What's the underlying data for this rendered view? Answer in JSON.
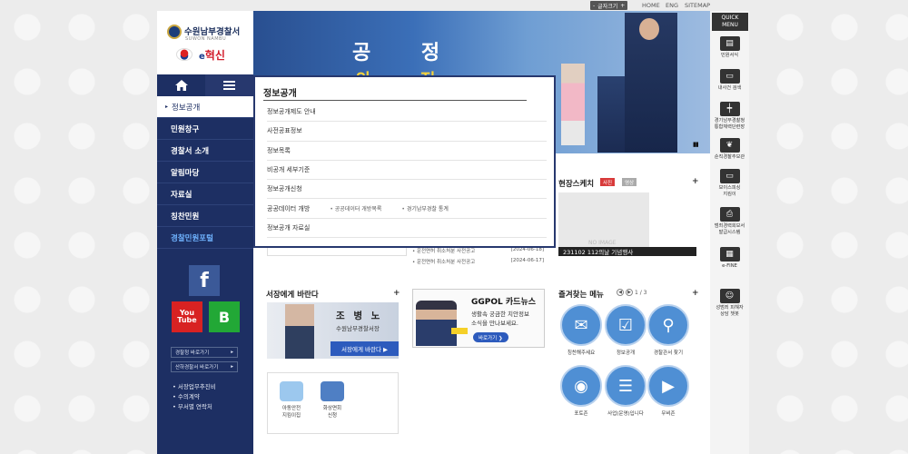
{
  "topbar": {
    "font_size_label": "글자크기",
    "font_minus": "-",
    "font_plus": "+",
    "links": [
      "HOME",
      "ENG",
      "SITEMAP"
    ]
  },
  "logo": {
    "title": "수원남부경찰서",
    "subtitle": "SUWON NAMBU",
    "slogan_e": "e",
    "slogan": "혁신"
  },
  "side_menu": [
    "정보공개",
    "민원창구",
    "경찰서 소개",
    "알림마당",
    "자료실",
    "칭찬민원",
    "경찰민원포털"
  ],
  "sns": {
    "facebook": "f",
    "youtube": "You Tube",
    "blog": "B"
  },
  "left_links": {
    "buttons": [
      "경찰청 바로가기",
      "산하경찰서 바로가기"
    ],
    "links": [
      "• 서장업무추진비",
      "• 수의계약",
      "• 부서별 연락처"
    ]
  },
  "banner": {
    "line1": "공 정",
    "line2": "안 전"
  },
  "dropdown": {
    "title": "정보공개",
    "items": [
      "정보공개제도 안내",
      "사전공표정보",
      "정보목록",
      "비공개 세부기준",
      "정보공개신청",
      "공공데이터 개방",
      "정보공개 자료실"
    ],
    "subs": [
      "공공데이터 개방목록",
      "경기남부경찰 통계"
    ]
  },
  "sketch": {
    "title": "현장스케치",
    "tag_photo": "사진",
    "tag_video": "영상",
    "plus": "+",
    "noimage": "NO IMAGE",
    "caption": "231102 112의날 기념행사"
  },
  "news": [
    {
      "title": "운전면허 취소처분 사전공고",
      "date": "[2024-06-18]"
    },
    {
      "title": "운전면허 취소처분 사전공고",
      "date": "[2024-06-17]"
    }
  ],
  "ceo": {
    "title": "서장에게 바란다",
    "plus": "+",
    "name": "조 병 노",
    "role": "수원남부경찰서장",
    "button": "서장에게 바란다 ▶"
  },
  "ggpol": {
    "title": "GGPOL 카드뉴스",
    "desc": "생활속 궁금한 치안정보\n소식을 만나보세요.",
    "button": "바로가기 ❯"
  },
  "favorites": {
    "title": "즐겨찾는 메뉴",
    "page": "1 / 3",
    "prev": "◀",
    "next": "▶",
    "plus": "+",
    "items": [
      "칭찬해주세요",
      "정보공개",
      "경찰관서 찾기",
      "포토존",
      "사업(운영)입니다",
      "무비존"
    ]
  },
  "services": [
    "아동안전\n지킴이집",
    "화상면회\n신청"
  ],
  "quick": {
    "title": "QUICK\nMENU",
    "items": [
      "민원서식",
      "내사건 검색",
      "경기남부경찰청\n통합체력단련장",
      "순직경찰추모관",
      "보이스피싱\n지킴이",
      "범죄경력회보서\n발급시스템",
      "e-FINE",
      "성범죄 피해자\n상담 챗봇"
    ]
  }
}
